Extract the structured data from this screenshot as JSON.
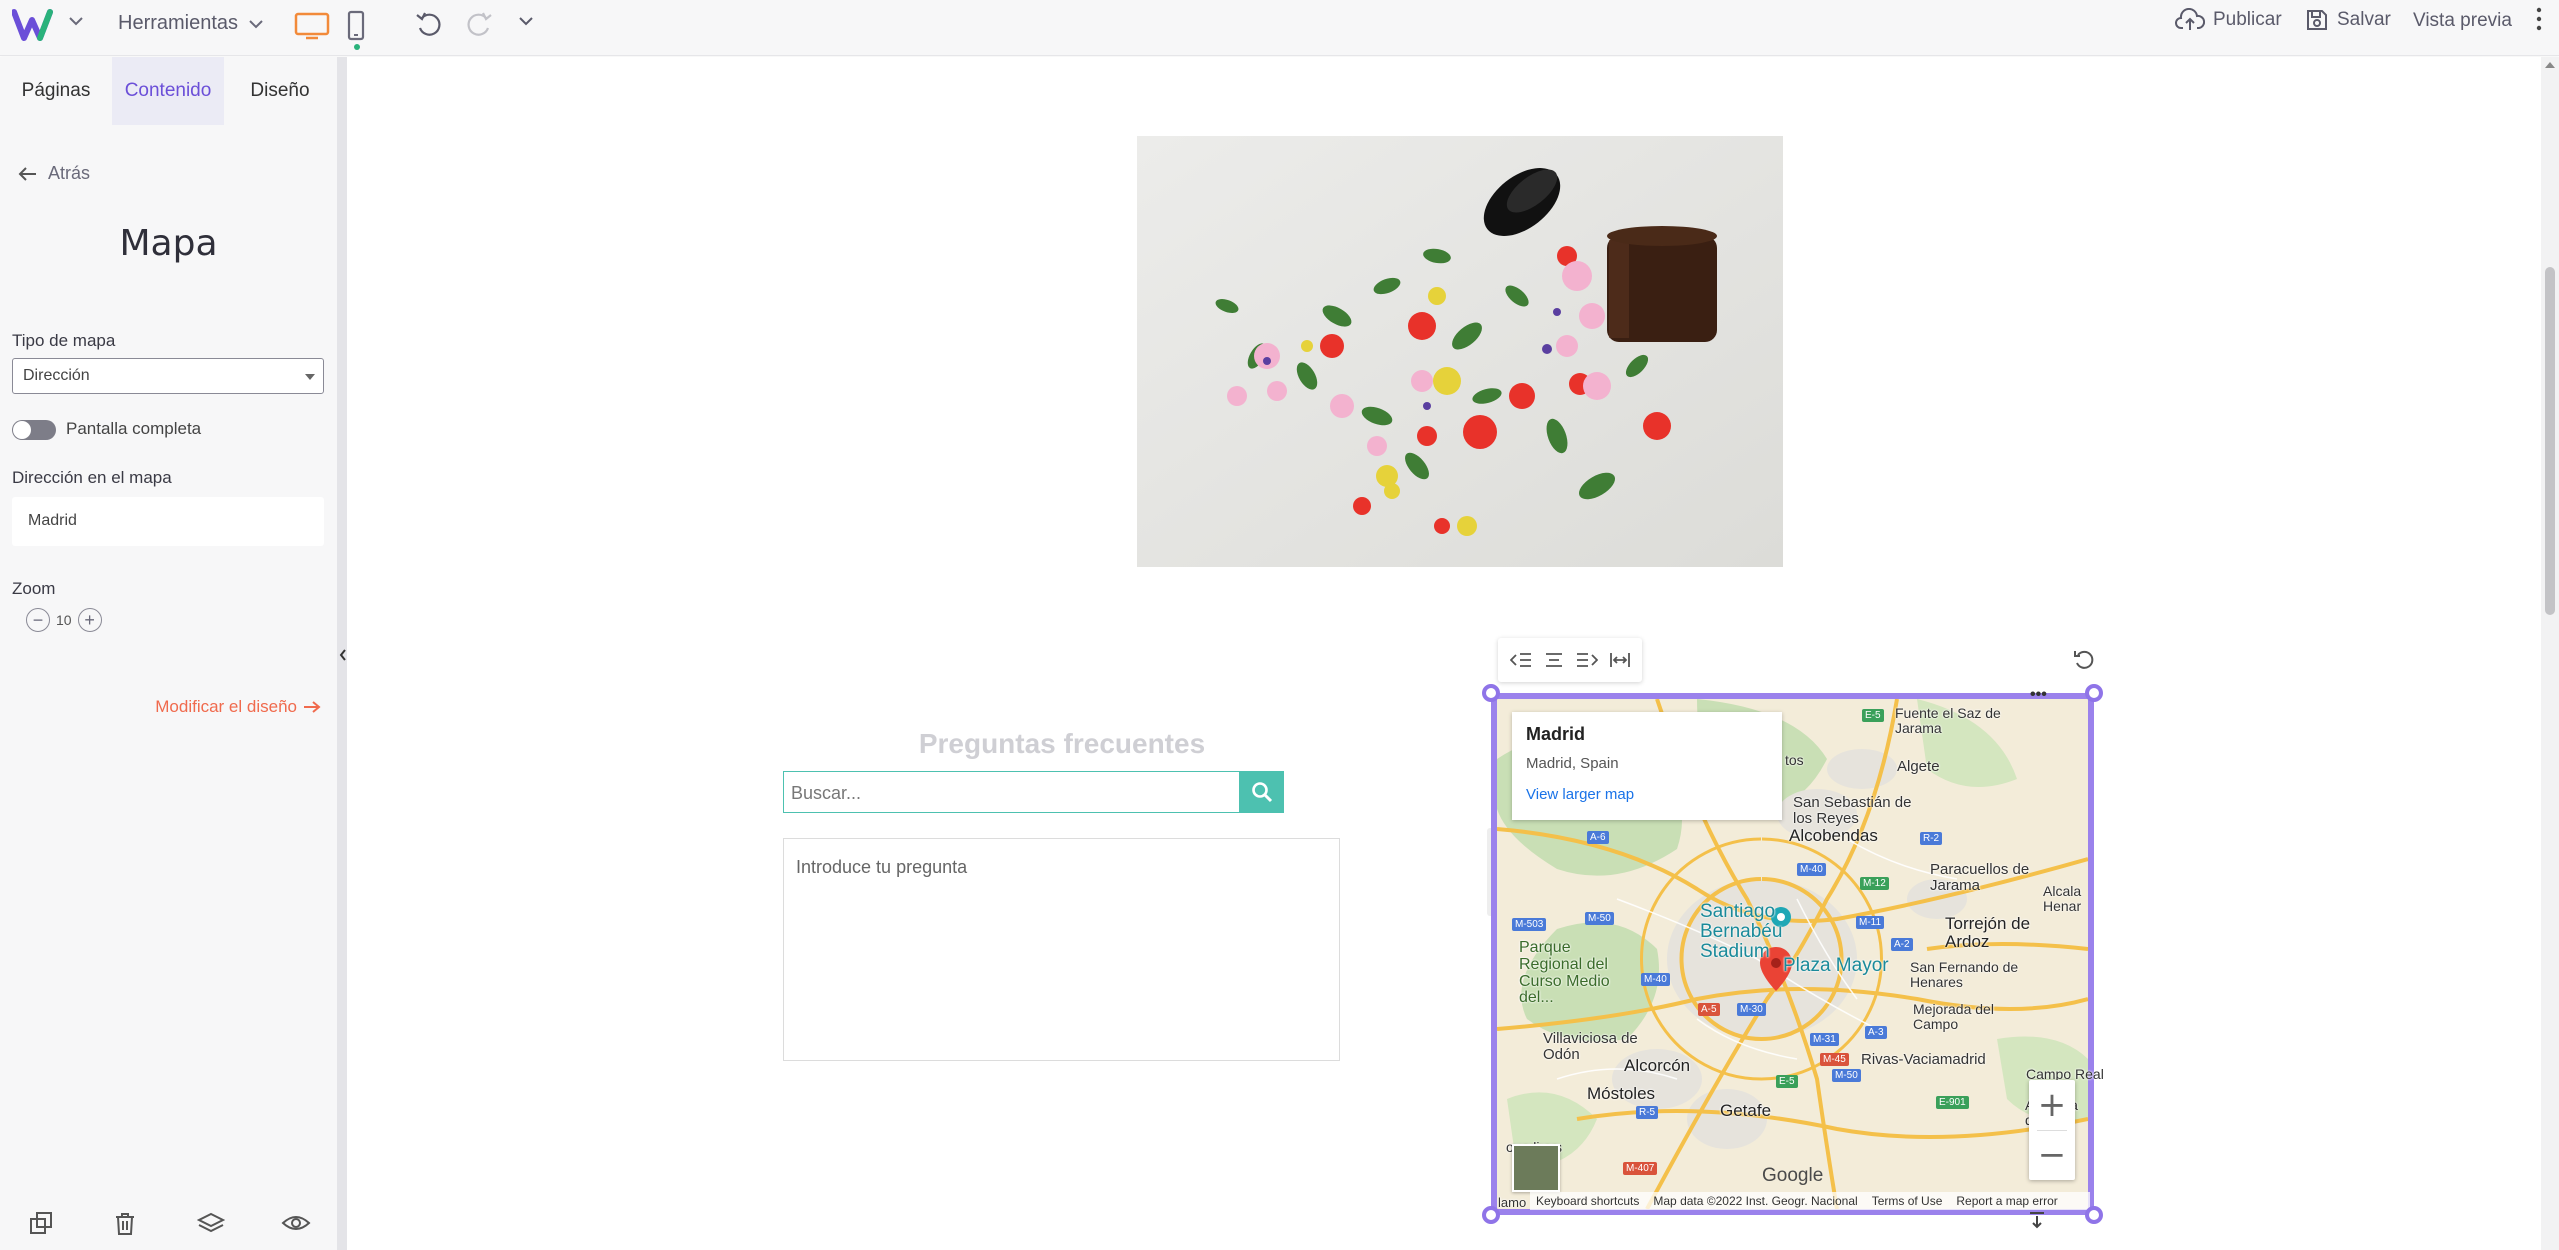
{
  "topbar": {
    "tools_label": "Herramientas",
    "publish_label": "Publicar",
    "save_label": "Salvar",
    "preview_label": "Vista previa",
    "accent_color": "#6b4fd8",
    "active_device_color": "#f28a3a"
  },
  "sidebar": {
    "tabs": [
      {
        "label": "Páginas",
        "active": false
      },
      {
        "label": "Contenido",
        "active": true
      },
      {
        "label": "Diseño",
        "active": false
      }
    ],
    "back_label": "Atrás",
    "title": "Mapa",
    "map_type": {
      "label": "Tipo de mapa",
      "value": "Dirección"
    },
    "fullscreen": {
      "label": "Pantalla completa",
      "enabled": false
    },
    "address": {
      "label": "Dirección en el mapa",
      "value": "Madrid"
    },
    "zoom": {
      "label": "Zoom",
      "value": "10"
    },
    "modify_design_label": "Modificar el diseño",
    "modify_color": "#f06a4d"
  },
  "canvas": {
    "faq": {
      "title": "Preguntas frecuentes",
      "search_placeholder": "Buscar...",
      "question_placeholder": "Introduce tu pregunta",
      "accent_color": "#4dc1b0"
    },
    "map": {
      "selection_color": "#9b82ec",
      "info_card": {
        "name": "Madrid",
        "address": "Madrid, Spain",
        "link": "View larger map"
      },
      "labels": {
        "bernabeu": "Santiago Bernabéu Stadium",
        "plaza": "Plaza Mayor",
        "alcobendas": "Alcobendas",
        "sanseb": "San Sebastián de los Reyes",
        "fuente": "Fuente el Saz de Jarama",
        "algete": "Algete",
        "paracuellos": "Paracuellos de Jarama",
        "torrejon": "Torrejón de Ardoz",
        "alcala": "Alcala Henar",
        "parque": "Parque Regional del Curso Medio del...",
        "villaviciosa": "Villaviciosa de Odón",
        "alcorcon": "Alcorcón",
        "mostoles": "Móstoles",
        "getafe": "Getafe",
        "rivas": "Rivas-Vaciamadrid",
        "sanfernando": "San Fernando de Henares",
        "mejorada": "Mejorada del Campo",
        "campo": "Campo Real",
        "arganda": "Arganda del Rey",
        "fuenlabrada": "omolinos",
        "alamo": "lamo",
        "tos": "tos"
      },
      "roads": [
        "E-5",
        "A-6",
        "M-40",
        "M-12",
        "R-2",
        "M-11",
        "A-2",
        "M-503",
        "M-50",
        "M-40",
        "A-5",
        "M-30",
        "M-31",
        "M-45",
        "A-3",
        "E-5",
        "M-50",
        "R-5",
        "M-407",
        "E-901"
      ],
      "google_label": "Google",
      "footer": {
        "shortcuts": "Keyboard shortcuts",
        "data": "Map data ©2022 Inst. Geogr. Nacional",
        "terms": "Terms of Use",
        "report": "Report a map error"
      },
      "zoom_in": "+",
      "zoom_out": "−",
      "more": "•••"
    }
  }
}
